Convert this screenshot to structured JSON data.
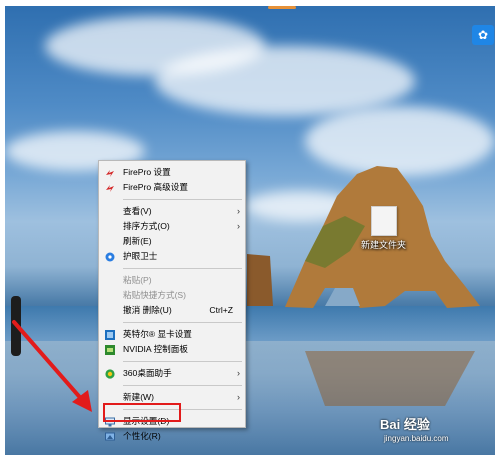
{
  "desktop": {
    "file_icon_label": "新建文件夹",
    "corner_button_icon": "cloud-icon"
  },
  "menu": {
    "items": [
      {
        "label": "FirePro 设置",
        "icon": "firepro-icon"
      },
      {
        "label": "FirePro 高级设置",
        "icon": "firepro-icon"
      },
      {
        "label": "查看(V)",
        "submenu": true
      },
      {
        "label": "排序方式(O)",
        "submenu": true
      },
      {
        "label": "刷新(E)"
      },
      {
        "label": "护眼卫士",
        "icon": "eye-guard-icon"
      },
      {
        "label": "粘贴(P)",
        "disabled": true
      },
      {
        "label": "粘贴快捷方式(S)",
        "disabled": true
      },
      {
        "label": "撤消 删除(U)",
        "shortcut": "Ctrl+Z"
      },
      {
        "label": "英特尔® 显卡设置",
        "icon": "intel-graphics-icon"
      },
      {
        "label": "NVIDIA 控制面板",
        "icon": "nvidia-icon"
      },
      {
        "label": "360桌面助手",
        "icon": "360-icon",
        "submenu": true
      },
      {
        "label": "新建(W)",
        "submenu": true
      },
      {
        "label": "显示设置(D)",
        "icon": "display-settings-icon"
      },
      {
        "label": "个性化(R)",
        "icon": "personalize-icon"
      }
    ]
  },
  "watermark": {
    "brand": "Bai 经验",
    "url": "jingyan.baidu.com"
  },
  "colors": {
    "highlight_box": "#e21b1b",
    "arrow": "#e21b1b",
    "menu_bg": "#f2f2f2"
  }
}
